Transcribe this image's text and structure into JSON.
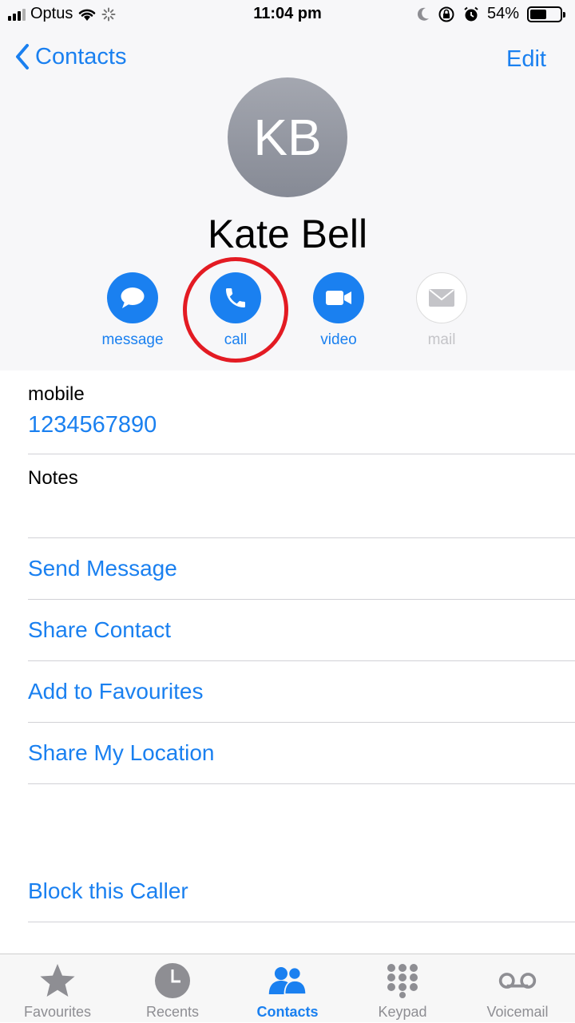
{
  "status_bar": {
    "carrier": "Optus",
    "time": "11:04 pm",
    "battery": "54%"
  },
  "nav": {
    "back_label": "Contacts",
    "edit_label": "Edit"
  },
  "contact": {
    "initials": "KB",
    "name": "Kate Bell"
  },
  "actions": [
    {
      "label": "message",
      "icon": "message-bubble-icon",
      "enabled": true
    },
    {
      "label": "call",
      "icon": "phone-icon",
      "enabled": true
    },
    {
      "label": "video",
      "icon": "video-camera-icon",
      "enabled": true
    },
    {
      "label": "mail",
      "icon": "envelope-icon",
      "enabled": false
    }
  ],
  "fields": {
    "mobile_label": "mobile",
    "mobile_value": "1234567890",
    "notes_label": "Notes"
  },
  "links": {
    "send_message": "Send Message",
    "share_contact": "Share Contact",
    "add_favourites": "Add to Favourites",
    "share_location": "Share My Location",
    "block_caller": "Block this Caller"
  },
  "tabs": [
    {
      "label": "Favourites",
      "icon": "star-icon",
      "active": false
    },
    {
      "label": "Recents",
      "icon": "clock-icon",
      "active": false
    },
    {
      "label": "Contacts",
      "icon": "contacts-people-icon",
      "active": true
    },
    {
      "label": "Keypad",
      "icon": "keypad-icon",
      "active": false
    },
    {
      "label": "Voicemail",
      "icon": "voicemail-icon",
      "active": false
    }
  ],
  "colors": {
    "accent": "#1a80f0",
    "annotation": "#e31b23",
    "disabled": "#c4c4c8",
    "inactive_tab": "#8e8e93"
  }
}
